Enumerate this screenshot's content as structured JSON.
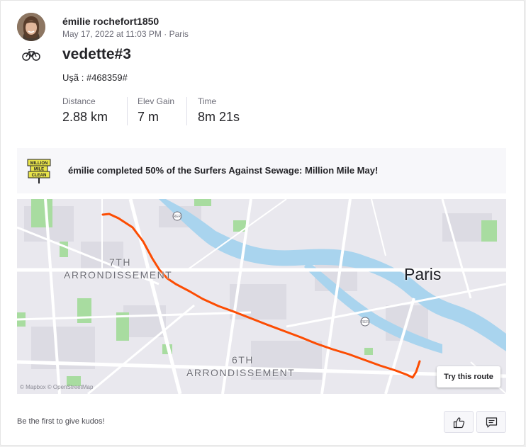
{
  "athlete": {
    "name": "émilie rochefort1850",
    "date": "May 17, 2022 at 11:03 PM",
    "location": "Paris"
  },
  "activity": {
    "sport_icon": "bicycle-icon",
    "title": "vedette#3",
    "description": "Uşã : #468359#"
  },
  "stats": [
    {
      "label": "Distance",
      "value": "2.88 km"
    },
    {
      "label": "Elev Gain",
      "value": "7 m"
    },
    {
      "label": "Time",
      "value": "8m 21s"
    }
  ],
  "challenge": {
    "badge_icon": "million-mile-clean-badge-icon",
    "badge_text": [
      "MILLION",
      "MILE",
      "CLEAN"
    ],
    "text": "émilie completed 50% of the Surfers Against Sewage: Million Mile May!"
  },
  "map": {
    "labels": {
      "arr7_line1": "7TH",
      "arr7_line2": "ARRONDISSEMENT",
      "arr6_line1": "6TH",
      "arr6_line2": "ARRONDISSEMENT",
      "city": "Paris",
      "rer": "RER"
    },
    "try_route": "Try this route",
    "copyright": "© Mapbox © OpenStreetMap",
    "route_color": "#fc4c02",
    "water_color": "#a9d4ee",
    "park_color": "#a8dca0"
  },
  "footer": {
    "kudos_text": "Be the first to give kudos!",
    "kudos_icon": "thumbs-up-icon",
    "comment_icon": "comment-icon"
  }
}
